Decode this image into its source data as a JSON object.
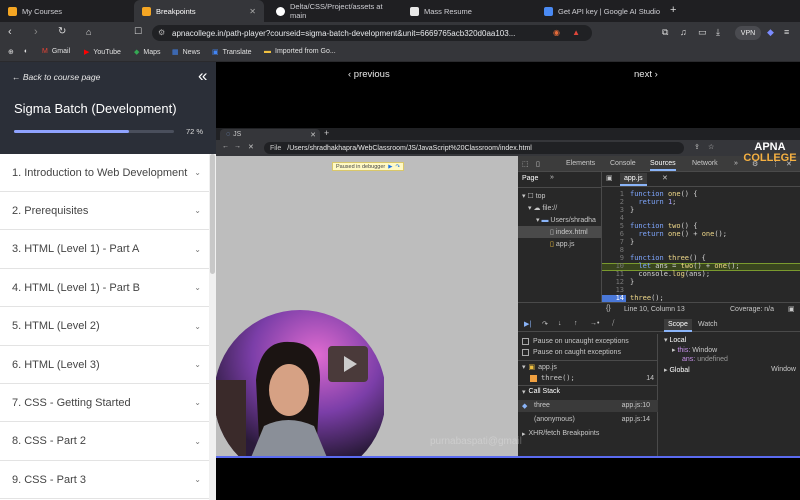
{
  "browser": {
    "tabs": [
      {
        "label": "My Courses"
      },
      {
        "label": "Breakpoints"
      },
      {
        "label": "Delta/CSS/Project/assets at main"
      },
      {
        "label": "Mass Resume"
      },
      {
        "label": "Get API key | Google AI Studio"
      }
    ],
    "url": "apnacollege.in/path-player?courseid=sigma-batch-development&unit=6669765acb320d0aa103...",
    "vpn_label": "VPN",
    "bookmarks": [
      "Gmail",
      "YouTube",
      "Maps",
      "News",
      "Translate",
      "Imported from Go..."
    ]
  },
  "sidebar": {
    "back_label": "← Back to course page",
    "course_title": "Sigma Batch (Development)",
    "progress_percent": 72,
    "progress_text": "72 %",
    "items": [
      {
        "label": "1. Introduction to Web Development"
      },
      {
        "label": "2. Prerequisites"
      },
      {
        "label": "3. HTML (Level 1) - Part A"
      },
      {
        "label": "4. HTML (Level 1) - Part B"
      },
      {
        "label": "5. HTML (Level 2)"
      },
      {
        "label": "6. HTML (Level 3)"
      },
      {
        "label": "7. CSS - Getting Started"
      },
      {
        "label": "8. CSS - Part 2"
      },
      {
        "label": "9. CSS - Part 3"
      }
    ]
  },
  "player": {
    "prev_label": "‹ previous",
    "next_label": "next ›",
    "watermark": "purnabaspati@gmail",
    "logo_line1": "APNA",
    "logo_line2": "COLLEGE"
  },
  "inner_browser": {
    "tab_label": "JS",
    "url_prefix": "File",
    "url": "/Users/shradhakhapra/WebClassroom/JS/JavaScript%20Classroom/index.html",
    "paused_label": "Paused in debugger"
  },
  "devtools": {
    "tabs": [
      "Elements",
      "Console",
      "Sources",
      "Network"
    ],
    "active_tab": "Sources",
    "page_tab": "Page",
    "tree": [
      "top",
      "file://",
      "Users/shradha",
      "index.html",
      "app.js"
    ],
    "file_tab": "app.js",
    "code_lines": [
      "function one() {",
      "  return 1;",
      "}",
      "",
      "function two() {",
      "  return one() + one();",
      "}",
      "",
      "function three() {",
      "  let ans = two() + one();",
      "  console.log(ans);",
      "}",
      "",
      "three();"
    ],
    "status_left": "Line 10, Column 13",
    "status_right": "Coverage: n/a",
    "pause_uncaught": "Pause on uncaught exceptions",
    "pause_caught": "Pause on caught exceptions",
    "bp_file": "app.js",
    "bp_line": "three();",
    "bp_line_num": "14",
    "callstack_title": "Call Stack",
    "callstack": [
      {
        "name": "three",
        "loc": "app.js:10"
      },
      {
        "name": "(anonymous)",
        "loc": "app.js:14"
      }
    ],
    "xhr_label": "XHR/fetch Breakpoints",
    "scope_tab": "Scope",
    "watch_tab": "Watch",
    "scope_local": "Local",
    "scope_this": "this:",
    "scope_this_val": "Window",
    "scope_ans": "ans:",
    "scope_ans_val": "undefined",
    "scope_global": "Global",
    "scope_global_val": "Window"
  }
}
